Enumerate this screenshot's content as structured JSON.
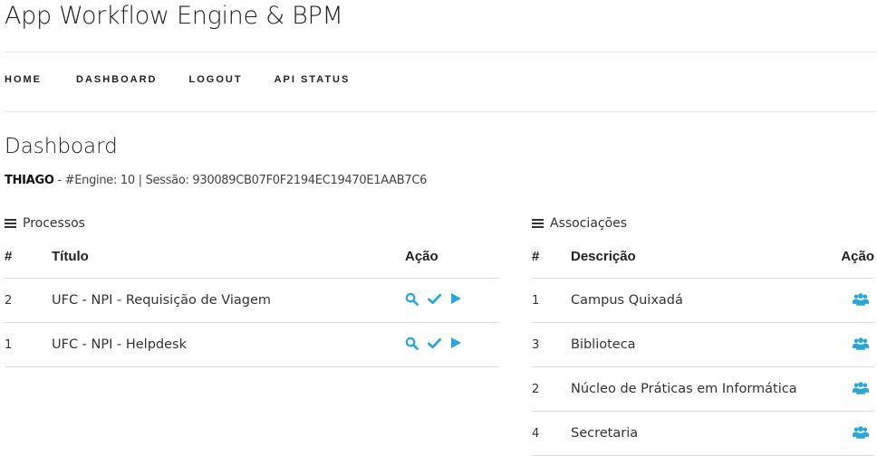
{
  "app": {
    "title": "App Workflow Engine & BPM"
  },
  "nav": [
    {
      "label": "HOME"
    },
    {
      "label": "DASHBOARD"
    },
    {
      "label": "LOGOUT"
    },
    {
      "label": "API STATUS"
    }
  ],
  "page": {
    "title": "Dashboard",
    "user": "THIAGO",
    "session_info": " - #Engine: 10 | Sessão: 930089CB07F0F2194EC19470E1AAB7C6"
  },
  "processos": {
    "heading": "Processos",
    "columns": [
      "#",
      "Título",
      "Ação"
    ],
    "rows": [
      {
        "id": "2",
        "titulo": "UFC - NPI - Requisição de Viagem"
      },
      {
        "id": "1",
        "titulo": "UFC - NPI - Helpdesk"
      }
    ]
  },
  "associacoes": {
    "heading": "Associações",
    "columns": [
      "#",
      "Descrição",
      "Ação"
    ],
    "rows": [
      {
        "id": "1",
        "descricao": "Campus Quixadá"
      },
      {
        "id": "3",
        "descricao": "Biblioteca"
      },
      {
        "id": "2",
        "descricao": "Núcleo de Práticas em Informática"
      },
      {
        "id": "4",
        "descricao": "Secretaria"
      }
    ]
  },
  "icons": {
    "action_color": "#29a8d8",
    "process_actions": [
      "search-icon",
      "check-icon",
      "play-icon"
    ],
    "association_action": "users-icon"
  }
}
